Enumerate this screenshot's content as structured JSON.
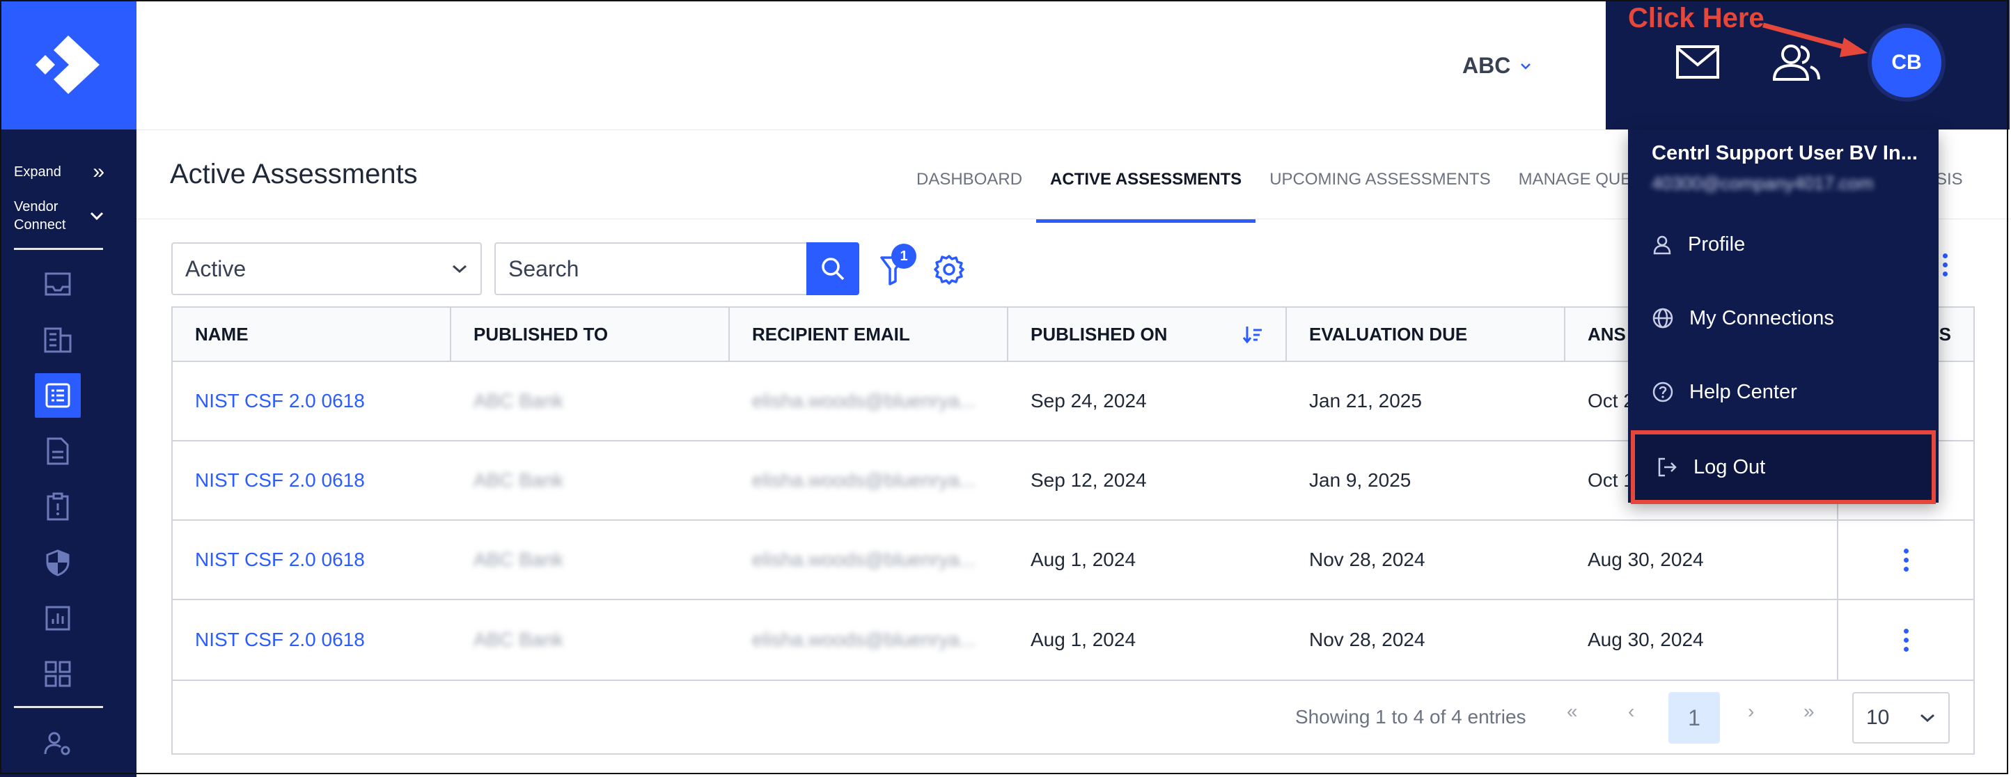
{
  "sidebar": {
    "expand_label": "Expand",
    "vendor_label_1": "Vendor",
    "vendor_label_2": "Connect"
  },
  "header": {
    "org": "ABC",
    "avatar_initials": "CB",
    "annotation": "Click Here"
  },
  "page": {
    "title": "Active Assessments",
    "tabs": [
      {
        "label": "DASHBOARD",
        "active": false
      },
      {
        "label": "ACTIVE ASSESSMENTS",
        "active": true
      },
      {
        "label": "UPCOMING ASSESSMENTS",
        "active": false
      },
      {
        "label": "MANAGE QUESTIO",
        "active": false
      },
      {
        "label": "SIS",
        "active": false
      }
    ]
  },
  "filters": {
    "status_value": "Active",
    "search_placeholder": "Search",
    "filter_count": "1"
  },
  "table": {
    "columns": [
      "NAME",
      "PUBLISHED TO",
      "RECIPIENT EMAIL",
      "PUBLISHED ON",
      "EVALUATION DUE",
      "ANS",
      "S"
    ],
    "rows": [
      {
        "name": "NIST CSF 2.0 0618",
        "published_to": "ABC Bank",
        "email": "elisha.woods@bluenrya...",
        "published_on": "Sep 24, 2024",
        "evaluation_due": "Jan 21, 2025",
        "answered": "Oct 2"
      },
      {
        "name": "NIST CSF 2.0 0618",
        "published_to": "ABC Bank",
        "email": "elisha.woods@bluenrya...",
        "published_on": "Sep 12, 2024",
        "evaluation_due": "Jan 9, 2025",
        "answered": "Oct 1"
      },
      {
        "name": "NIST CSF 2.0 0618",
        "published_to": "ABC Bank",
        "email": "elisha.woods@bluenrya...",
        "published_on": "Aug 1, 2024",
        "evaluation_due": "Nov 28, 2024",
        "answered": "Aug 30, 2024"
      },
      {
        "name": "NIST CSF 2.0 0618",
        "published_to": "ABC Bank",
        "email": "elisha.woods@bluenrya...",
        "published_on": "Aug 1, 2024",
        "evaluation_due": "Nov 28, 2024",
        "answered": "Aug 30, 2024"
      }
    ]
  },
  "pagination": {
    "showing": "Showing 1 to 4 of 4 entries",
    "current_page": "1",
    "page_size": "10"
  },
  "user_menu": {
    "name": "Centrl Support User BV In...",
    "email": "40300@company4017.com",
    "items": [
      {
        "label": "Profile",
        "icon": "person-icon"
      },
      {
        "label": "My Connections",
        "icon": "globe-icon"
      },
      {
        "label": "Help Center",
        "icon": "help-circle-icon"
      },
      {
        "label": "Log Out",
        "icon": "logout-icon"
      }
    ]
  },
  "colors": {
    "brand": "#2b5cff",
    "navy": "#0f1b4d",
    "annotation": "#e5483a"
  }
}
